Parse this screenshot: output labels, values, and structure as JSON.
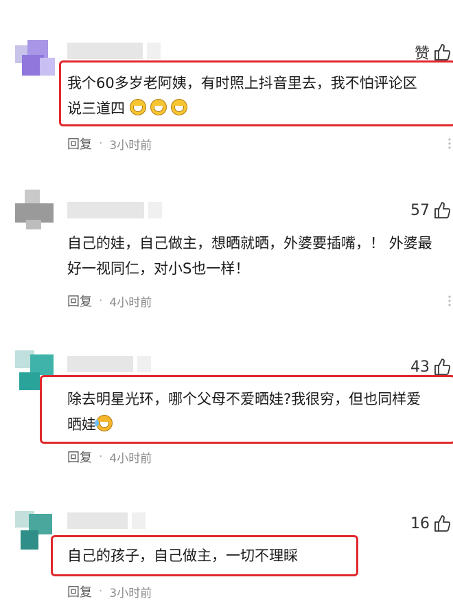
{
  "comments": [
    {
      "likes": "赞",
      "line1": "我个60多岁老阿姨，有时照上抖音里去，我不怕评论区",
      "line2": "说三道四",
      "emoji": [
        "grin-emoji",
        "grin-emoji",
        "grin-emoji"
      ],
      "reply_label": "回复",
      "separator": "·",
      "time": "3小时前",
      "highlighted": true
    },
    {
      "likes": "57",
      "line1": "自己的娃，自己做主，想晒就晒，外婆要插嘴，！ 外婆最",
      "line2": "好一视同仁，对小S也一样！",
      "reply_label": "回复",
      "separator": "·",
      "time": "4小时前",
      "highlighted": false
    },
    {
      "likes": "43",
      "line1": "除去明星光环，哪个父母不爱晒娃?我很穷，但也同样爱",
      "line2": "晒娃",
      "emoji": [
        "laugh-cry-emoji"
      ],
      "reply_label": "回复",
      "separator": "·",
      "time": "4小时前",
      "highlighted": true
    },
    {
      "likes": "16",
      "line1": "自己的孩子，自己做主，一切不理睬",
      "reply_label": "回复",
      "separator": "·",
      "time": "3小时前",
      "highlighted": true
    }
  ],
  "colors": {
    "highlight": "#e0282c",
    "meta": "#8a8a8a"
  },
  "icons": {
    "like": "thumbs-up-icon",
    "more": "more-icon"
  }
}
